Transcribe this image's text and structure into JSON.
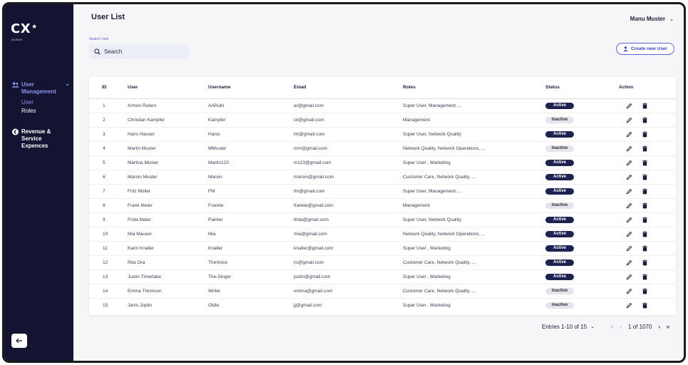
{
  "sidebar": {
    "logo": "CX",
    "logo_star": "★",
    "logo_sub": "ADMIN",
    "groups": [
      {
        "label": "User Management",
        "subitems": [
          "User",
          "Roles"
        ]
      },
      {
        "label": "Revenue & Service Expences"
      }
    ]
  },
  "header": {
    "title": "User List",
    "user_name": "Manu Muster"
  },
  "search": {
    "label": "Search User",
    "placeholder": "Search"
  },
  "create_button": "Create new User",
  "table": {
    "columns": [
      "ID",
      "User",
      "Username",
      "Email",
      "Roles",
      "Status",
      "Action"
    ],
    "rows": [
      [
        "1",
        "Armon Ruben",
        "AARubi",
        "ar@gmail.com",
        "Super User, Management, ...",
        "Active"
      ],
      [
        "2",
        "Christian Kampfer",
        "Kampfer",
        "ck@gmail.com",
        "Management",
        "Inactive"
      ],
      [
        "3",
        "Hans Hauser",
        "Hansi",
        "hh@gmail.com",
        "Super User, Network Quality",
        "Active"
      ],
      [
        "4",
        "Martin Muster",
        "MMuster",
        "mm@gmail.com",
        "Network Quality, Network Operations, ...",
        "Inactive"
      ],
      [
        "5",
        "Martina Muster",
        "Martin123",
        "m123@gmail.com",
        "Super User , Marketing",
        "Active"
      ],
      [
        "6",
        "Marion Muster",
        "Marion",
        "marion@gmail.com",
        "Customer Care, Network Quality, ...",
        "Active"
      ],
      [
        "7",
        "Fritz Müller",
        "FM",
        "fm@gmail.com",
        "Super User, Management, ...",
        "Active"
      ],
      [
        "8",
        "Frank Meier",
        "Frankie",
        "frankie@gmail.com",
        "Management",
        "Inactive"
      ],
      [
        "9",
        "Frida Maler",
        "Painter",
        "frida@gmail.com",
        "Super User, Network Quality",
        "Active"
      ],
      [
        "10",
        "Mia Mauser",
        "Mia",
        "mia@gmail.com",
        "Network Quality, Network Operations, ...",
        "Active"
      ],
      [
        "11",
        "Karin Knaller",
        "Knaller",
        "knaller@gmail.com",
        "Super User , Marketing",
        "Active"
      ],
      [
        "12",
        "Rita Ora",
        "TheVoice",
        "ro@gmail.com",
        "Customer Care, Network Quality, ...",
        "Active"
      ],
      [
        "13",
        "Justin Timerlake",
        "The-Singer",
        "justin@gmail.com",
        "Super User , Marketing",
        "Active"
      ],
      [
        "14",
        "Emma Thomson",
        "Writer",
        "emma@gmail.com",
        "Customer Care, Network Quality, ...",
        "Inactive"
      ],
      [
        "15",
        "Janis Joplin",
        "Oldie",
        "jj@gmail.com",
        "Super User , Marketing",
        "Inactive"
      ]
    ]
  },
  "pagination": {
    "entries": "Entries 1-10 of 15",
    "page_info": "1 of 1070"
  },
  "colors": {
    "sidebar": "#141331",
    "accent": "#5b63d6",
    "active_badge": "#1e2250",
    "inactive_badge": "#e4e5ea"
  },
  "icons": [
    "users-icon",
    "chevron-down-icon",
    "arrow-left-circle-icon",
    "arrow-left-icon",
    "search-icon",
    "user-icon",
    "pencil-icon",
    "trash-icon",
    "first-page-icon",
    "prev-page-icon",
    "next-page-icon",
    "last-page-icon"
  ]
}
